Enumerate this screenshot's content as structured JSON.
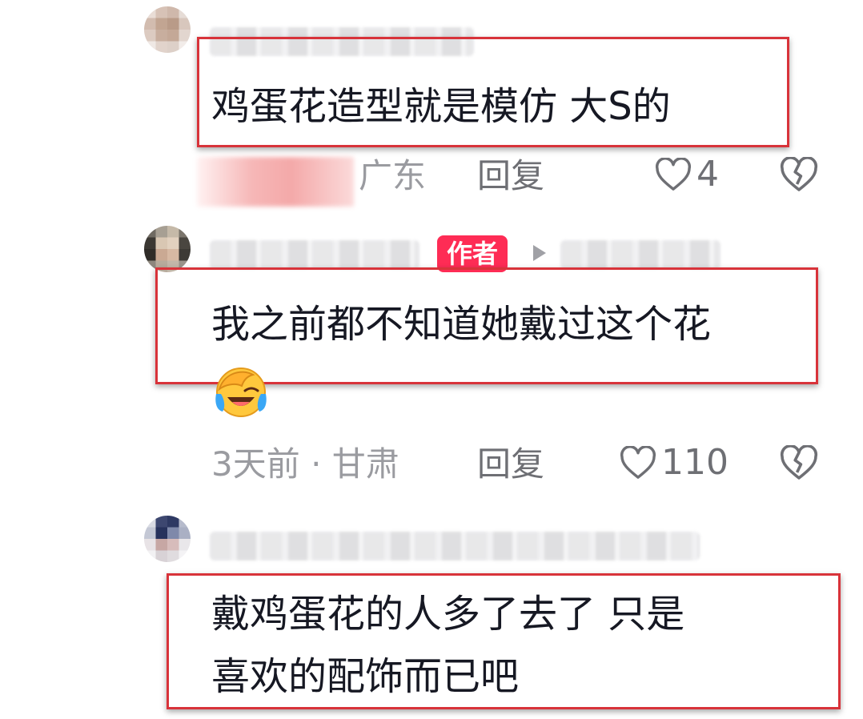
{
  "comments": [
    {
      "text": "鸡蛋花造型就是模仿 大S的",
      "location": "广东",
      "reply_label": "回复",
      "likes": "4"
    },
    {
      "author_badge": "作者",
      "text": "我之前都不知道她戴过这个花",
      "emoji": "😭",
      "time_location": "3天前 · 甘肃",
      "reply_label": "回复",
      "likes": "110"
    },
    {
      "text_line1": "戴鸡蛋花的人多了去了 只是",
      "text_line2": "喜欢的配饰而已吧"
    }
  ],
  "colors": {
    "highlight_box": "#d8333a",
    "author_badge": "#fe2c55",
    "meta_text": "#9a9ba0"
  }
}
